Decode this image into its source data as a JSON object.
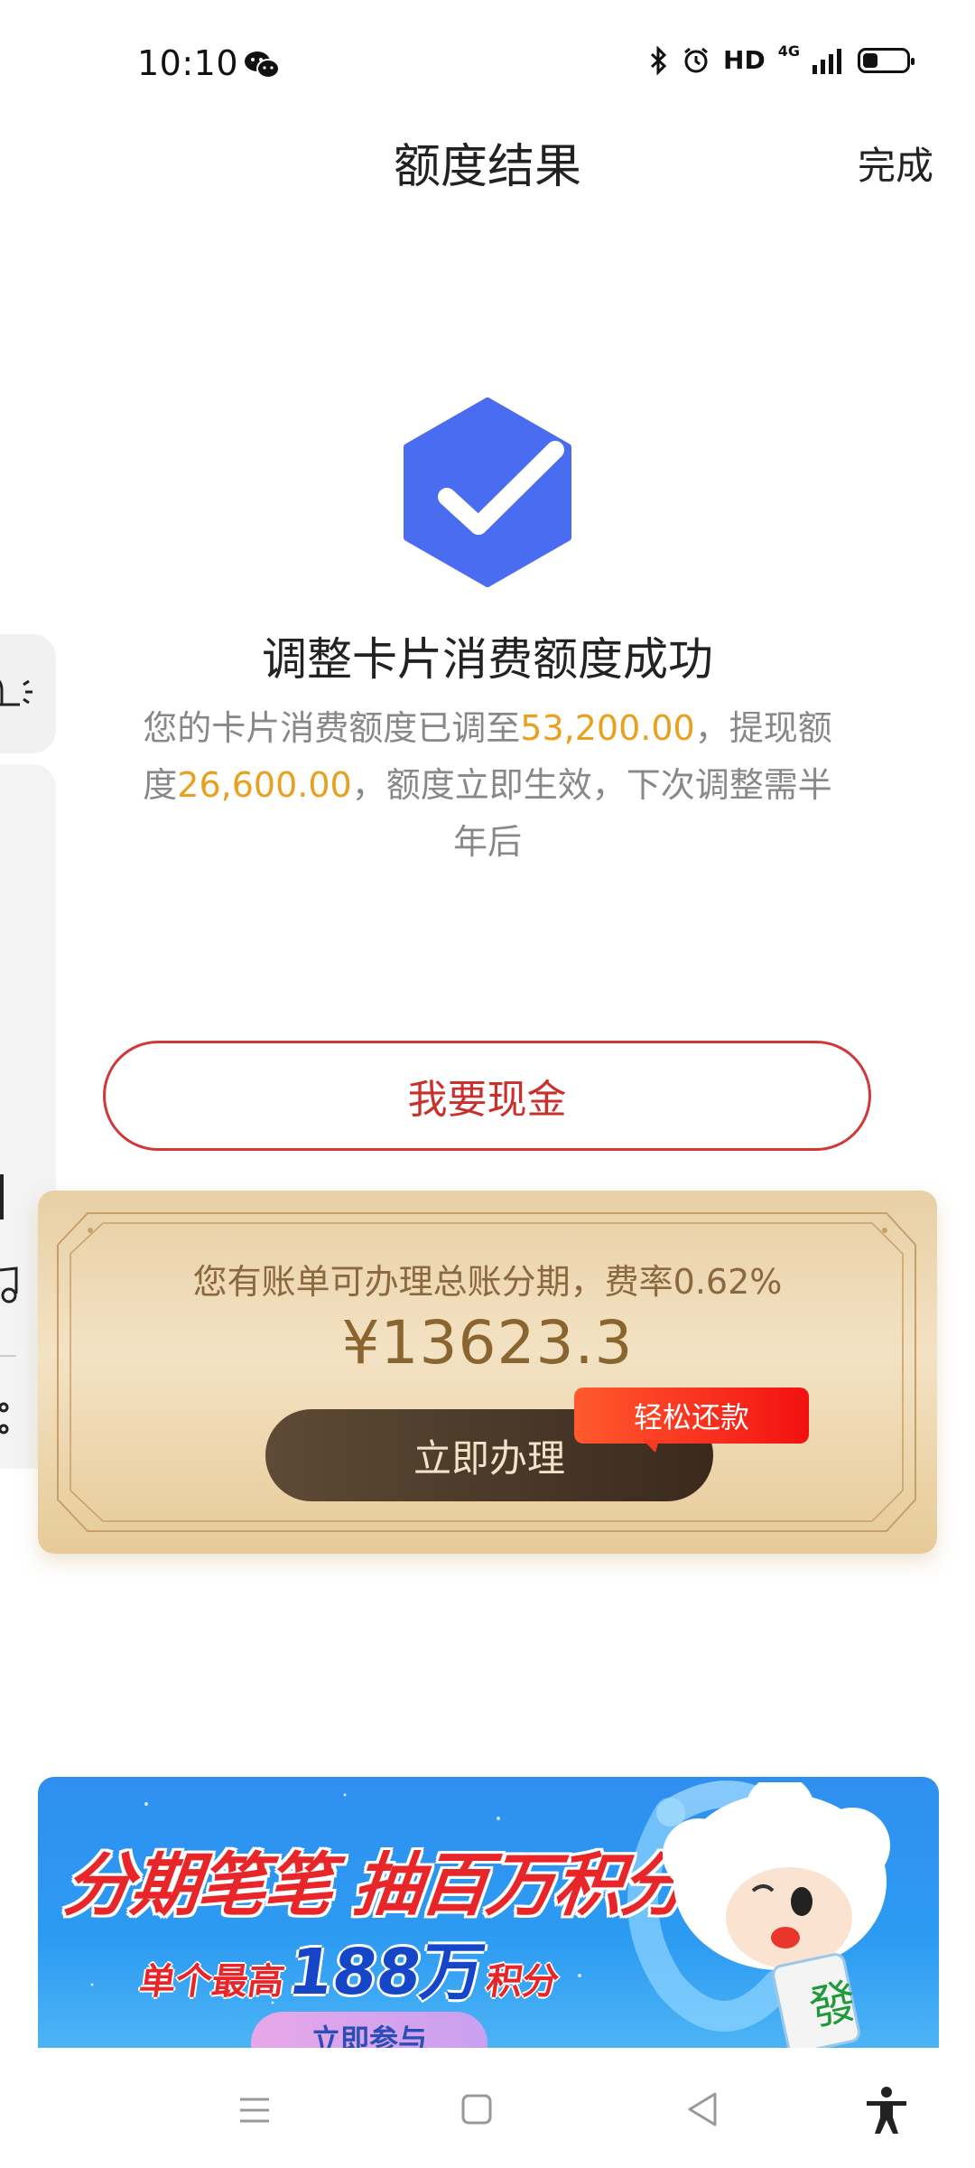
{
  "status_bar": {
    "time": "10:10",
    "hd_label": "HD",
    "network_label": "4G",
    "battery_level": 0.3
  },
  "header": {
    "title": "额度结果",
    "done_label": "完成"
  },
  "result": {
    "title": "调整卡片消费额度成功",
    "desc_part1": "您的卡片消费额度已调至",
    "consumption_limit": "53,200.00",
    "desc_part2": "，提现额度",
    "cash_limit": "26,600.00",
    "desc_part3": "，额度立即生效，下次调整需半年后",
    "icon": "check-shield-icon",
    "icon_color": "#4A6CF0"
  },
  "cash_button": {
    "label": "我要现金",
    "color": "#C9302C"
  },
  "installment": {
    "text": "您有账单可办理总账分期，费率0.62%",
    "amount": "¥13623.3",
    "apply_label": "立即办理",
    "badge_label": "轻松还款"
  },
  "banner": {
    "title": "分期笔笔 抽百万积分",
    "sub_prefix": "单个最高",
    "sub_big": "188万",
    "sub_suffix": "积分",
    "join_label": "立即参与",
    "mascot_tile_char": "發"
  },
  "nav_bar": {
    "icons": [
      "menu-icon",
      "home-square-icon",
      "back-triangle-icon",
      "accessibility-icon"
    ]
  }
}
